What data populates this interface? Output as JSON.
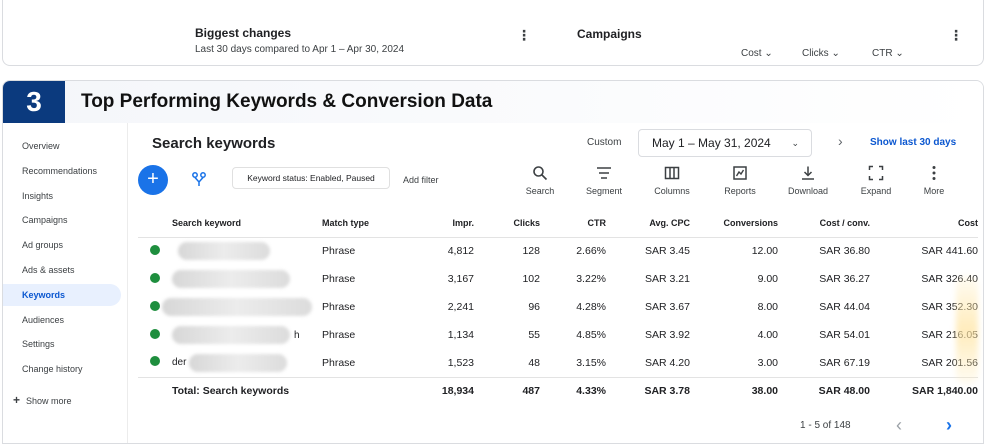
{
  "top_card": {
    "biggest_changes": {
      "title": "Biggest changes",
      "subtitle": "Last 30 days compared to Apr 1 – Apr 30, 2024"
    },
    "campaigns": {
      "title": "Campaigns",
      "metrics": [
        "Cost",
        "Clicks",
        "CTR"
      ]
    }
  },
  "section": {
    "number": "3",
    "title": "Top Performing Keywords & Conversion Data"
  },
  "sidebar": {
    "items": [
      {
        "label": "Overview"
      },
      {
        "label": "Recommendations"
      },
      {
        "label": "Insights"
      },
      {
        "label": "Campaigns"
      },
      {
        "label": "Ad groups"
      },
      {
        "label": "Ads & assets"
      },
      {
        "label": "Keywords"
      },
      {
        "label": "Audiences"
      },
      {
        "label": "Settings"
      },
      {
        "label": "Change history"
      }
    ],
    "active": "Keywords",
    "show_more": "Show more"
  },
  "content": {
    "title": "Search keywords",
    "date_mode": "Custom",
    "date_range": "May 1 – May 31, 2024",
    "show_last": "Show last 30 days",
    "filter_chip": "Keyword status: Enabled, Paused",
    "add_filter": "Add filter",
    "tools": [
      "Search",
      "Segment",
      "Columns",
      "Reports",
      "Download",
      "Expand",
      "More"
    ],
    "table": {
      "headers": [
        "Search keyword",
        "Match type",
        "Impr.",
        "Clicks",
        "CTR",
        "Avg. CPC",
        "Conversions",
        "Cost / conv.",
        "Cost"
      ],
      "rows": [
        {
          "keyword": "",
          "match": "Phrase",
          "impr": "4,812",
          "clicks": "128",
          "ctr": "2.66%",
          "cpc": "SAR 3.45",
          "conv": "12.00",
          "cpconv": "SAR 36.80",
          "cost": "SAR 441.60"
        },
        {
          "keyword": "",
          "match": "Phrase",
          "impr": "3,167",
          "clicks": "102",
          "ctr": "3.22%",
          "cpc": "SAR 3.21",
          "conv": "9.00",
          "cpconv": "SAR 36.27",
          "cost": "SAR 326.40"
        },
        {
          "keyword": "",
          "match": "Phrase",
          "impr": "2,241",
          "clicks": "96",
          "ctr": "4.28%",
          "cpc": "SAR 3.67",
          "conv": "8.00",
          "cpconv": "SAR 44.04",
          "cost": "SAR 352.30"
        },
        {
          "keyword": "h",
          "match": "Phrase",
          "impr": "1,134",
          "clicks": "55",
          "ctr": "4.85%",
          "cpc": "SAR 3.92",
          "conv": "4.00",
          "cpconv": "SAR 54.01",
          "cost": "SAR 216.05"
        },
        {
          "keyword": "der",
          "match": "Phrase",
          "impr": "1,523",
          "clicks": "48",
          "ctr": "3.15%",
          "cpc": "SAR 4.20",
          "conv": "3.00",
          "cpconv": "SAR 67.19",
          "cost": "SAR 201.56"
        }
      ],
      "total": {
        "label": "Total: Search keywords",
        "impr": "18,934",
        "clicks": "487",
        "ctr": "4.33%",
        "cpc": "SAR 3.78",
        "conv": "38.00",
        "cpconv": "SAR 48.00",
        "cost": "SAR 1,840.00"
      }
    },
    "pagination": "1 - 5 of 148"
  },
  "colors": {
    "accent": "#1a73e8",
    "section_badge": "#0b3a7e",
    "status_enabled": "#1e8e3e",
    "active_nav_bg": "#e8f0fe"
  }
}
